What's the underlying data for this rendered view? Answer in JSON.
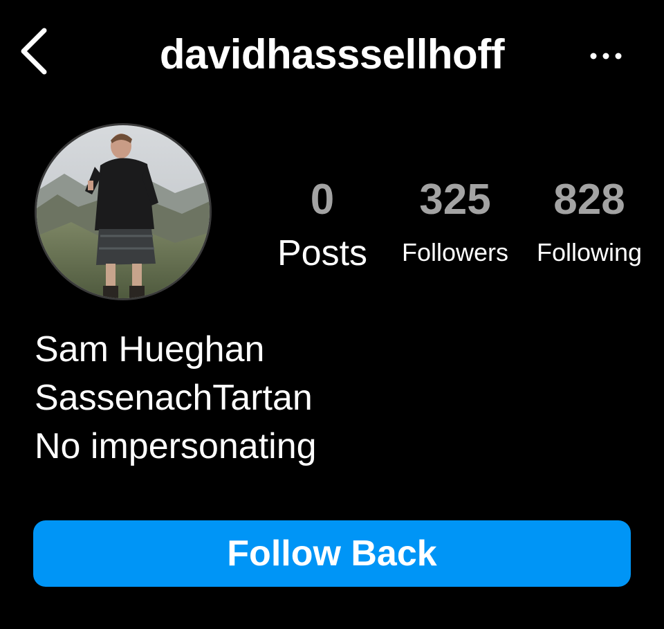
{
  "header": {
    "username": "davidhasssellhoff",
    "back_icon": "chevron-left-icon",
    "more_icon": "ellipsis-icon"
  },
  "profile": {
    "avatar_description_icon": "profile-photo",
    "stats": {
      "posts": {
        "value": "0",
        "label": "Posts"
      },
      "followers": {
        "value": "325",
        "label": "Followers"
      },
      "following": {
        "value": "828",
        "label": "Following"
      }
    },
    "bio": {
      "name": "Sam Hueghan",
      "line2": "SassenachTartan",
      "line3": "No impersonating"
    }
  },
  "actions": {
    "follow_back_label": "Follow Back"
  },
  "colors": {
    "background": "#000000",
    "text": "#ffffff",
    "stat_number": "#a3a3a3",
    "button": "#0095f6"
  }
}
